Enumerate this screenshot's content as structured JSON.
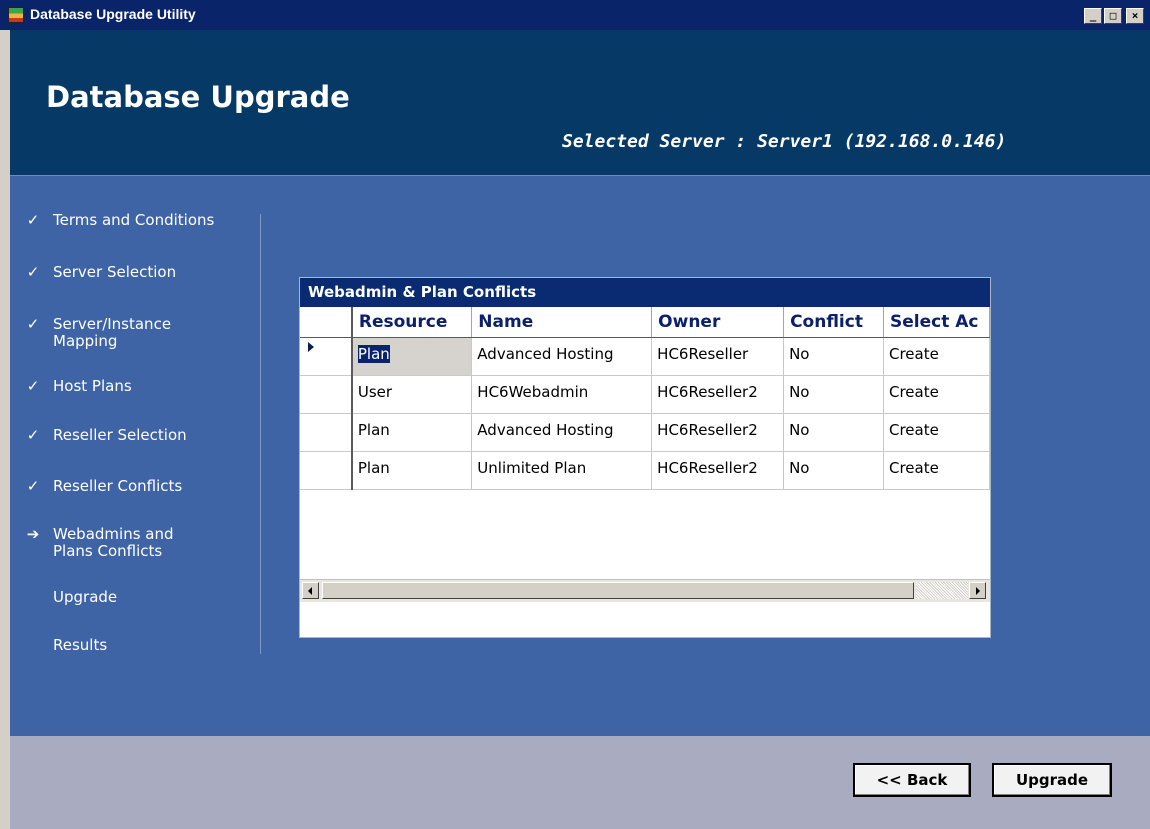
{
  "window": {
    "title": "Database Upgrade Utility",
    "controls": {
      "minimize": "_",
      "maximize": "□",
      "close": "×"
    }
  },
  "header": {
    "title": "Database Upgrade",
    "selected_server": "Selected Server : Server1 (192.168.0.146)"
  },
  "steps": [
    {
      "label": "Terms and Conditions",
      "status": "done",
      "mark": "✓"
    },
    {
      "label": "Server Selection",
      "status": "done",
      "mark": "✓"
    },
    {
      "label": "Server/Instance Mapping",
      "status": "done",
      "mark": "✓"
    },
    {
      "label": "Host Plans",
      "status": "done",
      "mark": "✓"
    },
    {
      "label": "Reseller Selection",
      "status": "done",
      "mark": "✓"
    },
    {
      "label": "Reseller Conflicts",
      "status": "done",
      "mark": "✓"
    },
    {
      "label": "Webadmins and Plans Conflicts",
      "status": "current",
      "mark": "➔"
    },
    {
      "label": "Upgrade",
      "status": "pending",
      "mark": ""
    },
    {
      "label": "Results",
      "status": "pending",
      "mark": ""
    }
  ],
  "grid": {
    "caption": "Webadmin & Plan Conflicts",
    "columns": [
      "Resource",
      "Name",
      "Owner",
      "Conflict",
      "Select Ac"
    ],
    "rows": [
      [
        "Plan",
        "Advanced Hosting",
        "HC6Reseller",
        "No",
        "Create"
      ],
      [
        "User",
        "HC6Webadmin",
        "HC6Reseller2",
        "No",
        "Create"
      ],
      [
        "Plan",
        "Advanced Hosting",
        "HC6Reseller2",
        "No",
        "Create"
      ],
      [
        "Plan",
        "Unlimited Plan",
        "HC6Reseller2",
        "No",
        "Create"
      ]
    ],
    "current_row": 0
  },
  "buttons": {
    "back": "<< Back",
    "upgrade": "Upgrade"
  },
  "colors": {
    "header_bg": "#063966",
    "content_bg": "#3f64a6",
    "grid_caption_bg": "#0a2b72",
    "footer_bg": "#a9acc0"
  }
}
